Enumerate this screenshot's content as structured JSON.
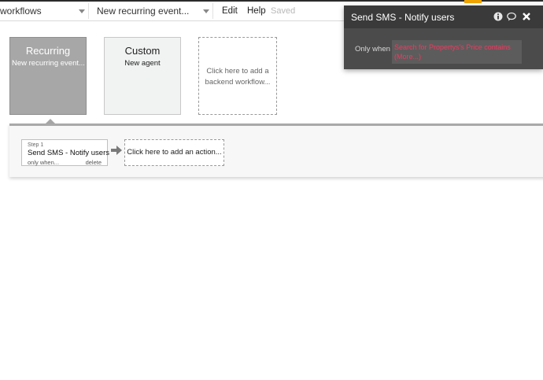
{
  "toolbar": {
    "page_dropdown": "workflows",
    "workflow_dropdown": "New recurring event...",
    "edit_label": "Edit",
    "help_label": "Help",
    "saved_label": "Saved"
  },
  "events": [
    {
      "title": "Recurring",
      "subtitle": "New recurring event..."
    },
    {
      "title": "Custom",
      "subtitle": "New agent"
    },
    {
      "add_text": "Click here to add a backend workflow..."
    }
  ],
  "workflow": {
    "step": {
      "number": "Step 1",
      "name": "Send SMS - Notify users",
      "only_when": "only when...",
      "delete": "delete"
    },
    "add_action": "Click here to add an action..."
  },
  "popup": {
    "title": "Send SMS - Notify users",
    "only_when_label": "Only when",
    "condition": "Search for Propertys's Price contains",
    "condition_more": "(More...)",
    "icons": [
      "info-icon",
      "comment-icon",
      "close-icon"
    ]
  },
  "colors": {
    "selected_card": "#a7a7a7",
    "condition_text": "#f2385f",
    "popup_bg": "#4b4b4b",
    "accent_tab": "#f0a500"
  }
}
